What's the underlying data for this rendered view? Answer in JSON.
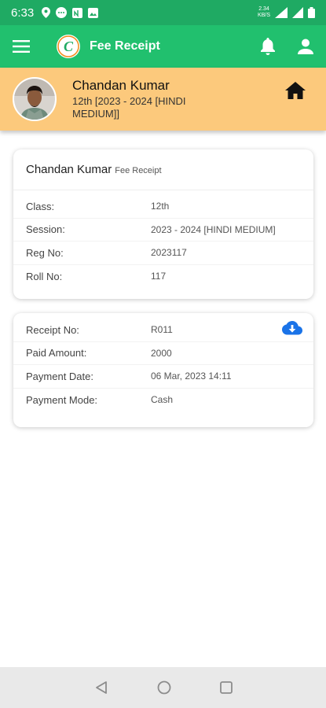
{
  "status_bar": {
    "time": "6:33",
    "net_speed_value": "2.34",
    "net_speed_unit": "KB/S",
    "icons": [
      "location-icon",
      "chat-icon",
      "nfc-icon",
      "image-icon",
      "wifi-icon",
      "signal-icon",
      "signal-icon",
      "battery-icon"
    ]
  },
  "app_bar": {
    "title": "Fee Receipt",
    "logo_letter": "C",
    "icons": [
      "menu-icon",
      "app-logo",
      "bell-icon",
      "user-icon"
    ],
    "colors": {
      "status": "#1faa63",
      "bar": "#21c06e"
    }
  },
  "profile": {
    "name": "Chandan Kumar",
    "class_line": "12th [2023 - 2024 [HINDI MEDIUM]]",
    "banner_color": "#fcc97c"
  },
  "student_card": {
    "name": "Chandan Kumar",
    "subtitle": "Fee Receipt",
    "rows": [
      {
        "label": "Class:",
        "value": "12th"
      },
      {
        "label": "Session:",
        "value": "2023 - 2024 [HINDI MEDIUM]"
      },
      {
        "label": "Reg No:",
        "value": "2023117"
      },
      {
        "label": "Roll No:",
        "value": "117"
      }
    ]
  },
  "receipt_card": {
    "rows": [
      {
        "label": "Receipt No:",
        "value": "R011"
      },
      {
        "label": "Paid Amount:",
        "value": "2000"
      },
      {
        "label": "Payment Date:",
        "value": "06 Mar, 2023 14:11"
      },
      {
        "label": "Payment Mode:",
        "value": "Cash"
      }
    ],
    "download_icon": "cloud-download-icon",
    "accent": "#1a73e8"
  },
  "nav_bar": {
    "buttons": [
      "back-icon",
      "home-circle-icon",
      "recents-icon"
    ]
  }
}
